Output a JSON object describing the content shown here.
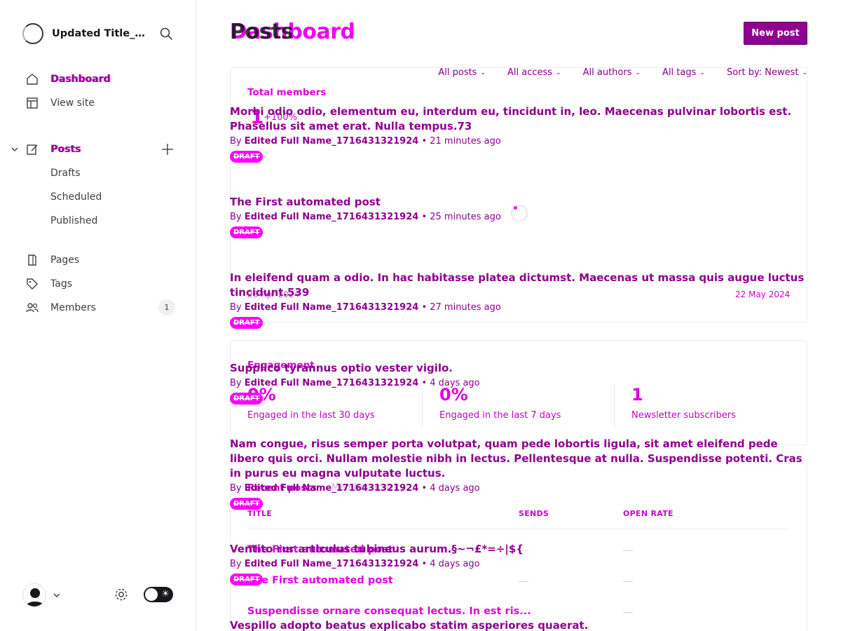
{
  "sidebar": {
    "site_title": "Updated Title_17...",
    "items": [
      {
        "label": "Dashboard"
      },
      {
        "label": "View site"
      },
      {
        "label": "Posts"
      },
      {
        "label": "Drafts"
      },
      {
        "label": "Scheduled"
      },
      {
        "label": "Published"
      },
      {
        "label": "Pages"
      },
      {
        "label": "Tags"
      },
      {
        "label": "Members"
      }
    ],
    "members_count": "1"
  },
  "header": {
    "title_under": "Dashboard",
    "title": "Posts",
    "new_post_label": "New post"
  },
  "filters": [
    "All posts",
    "All access",
    "All authors",
    "All tags",
    "Sort by: Newest"
  ],
  "dashboard": {
    "total_members_label": "Total members",
    "total_members_value": "1",
    "total_members_change": "+100%",
    "date_start": "23 Apr 2024",
    "date_end": "22 May 2024",
    "engagement_label": "Engagement",
    "stats": [
      {
        "value": "0%",
        "label": "Engaged in the last 30 days"
      },
      {
        "value": "0%",
        "label": "Engaged in the last 7 days"
      },
      {
        "value": "1",
        "label": "Newsletter subscribers"
      }
    ],
    "recent_posts_tab": "Recent posts",
    "member_activity_tab": "Member activity",
    "columns": [
      "TITLE",
      "SENDS",
      "OPEN RATE"
    ],
    "rows": [
      "The First automated post",
      "The First automated post",
      "Suspendisse ornare consequat lectus. In est ris..."
    ]
  },
  "posts": [
    {
      "title": "Morbi odio odio, elementum eu, interdum eu, tincidunt in, leo. Maecenas pulvinar lobortis est. Phasellus sit amet erat. Nulla tempus.73",
      "by": "By",
      "author": "Edited Full Name_1716431321924",
      "time": " • 21 minutes ago",
      "status": "DRAFT"
    },
    {
      "title": "The First automated post",
      "by": "By",
      "author": "Edited Full Name_1716431321924",
      "time": " • 25 minutes ago",
      "status": "DRAFT"
    },
    {
      "title": "In eleifend quam a odio. In hac habitasse platea dictumst. Maecenas ut massa quis augue luctus tincidunt.539",
      "by": "By",
      "author": "Edited Full Name_1716431321924",
      "time": " • 27 minutes ago",
      "status": "DRAFT"
    },
    {
      "title": "Supplico tyrannus optio vester vigilo.",
      "by": "By",
      "author": "Edited Full Name_1716431321924",
      "time": " • 4 days ago",
      "status": "DRAFT"
    },
    {
      "title": "Nam congue, risus semper porta volutpat, quam pede lobortis ligula, sit amet eleifend pede libero quis orci. Nullam molestie nibh in lectus. Pellentesque at nulla. Suspendisse potenti. Cras in purus eu magna vulputate luctus.",
      "by": "By",
      "author": "Edited Full Name_1716431321924",
      "time": " • 4 days ago",
      "status": "DRAFT"
    },
    {
      "title": "Ventito rur articulus tubineus aurum.§~¬£*=÷|${",
      "by": "By",
      "author": "Edited Full Name_1716431321924",
      "time": " • 4 days ago",
      "status": "DRAFT"
    },
    {
      "title": "Vespillo adopto beatus explicabo statim asperiores quaerat."
    }
  ]
}
